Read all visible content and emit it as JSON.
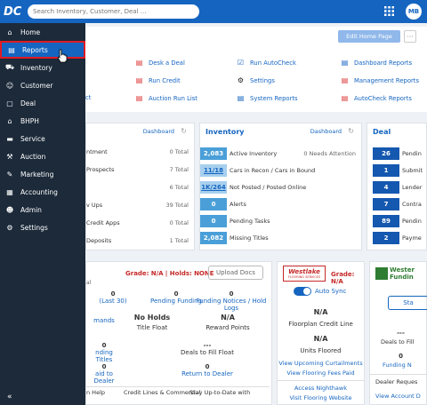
{
  "header": {
    "logo": "DC",
    "search_placeholder": "Search Inventory, Customer, Deal ...",
    "avatar": "MB"
  },
  "sidebar": {
    "items": [
      {
        "label": "Home",
        "icon": "home-icon"
      },
      {
        "label": "Reports",
        "icon": "report-icon",
        "active": true
      },
      {
        "label": "Inventory",
        "icon": "car-icon"
      },
      {
        "label": "Customer",
        "icon": "person-icon"
      },
      {
        "label": "Deal",
        "icon": "deal-icon"
      },
      {
        "label": "BHPH",
        "icon": "bhph-icon"
      },
      {
        "label": "Service",
        "icon": "service-icon"
      },
      {
        "label": "Auction",
        "icon": "auction-icon"
      },
      {
        "label": "Marketing",
        "icon": "marketing-icon"
      },
      {
        "label": "Accounting",
        "icon": "accounting-icon"
      },
      {
        "label": "Admin",
        "icon": "admin-icon"
      },
      {
        "label": "Settings",
        "icon": "settings-icon"
      }
    ],
    "collapse": "«"
  },
  "quick": {
    "edit_label": "Edit Home Page",
    "more": "···",
    "col0": [
      "ct"
    ],
    "col1": [
      "Desk a Deal",
      "Run Credit",
      "Auction Run List"
    ],
    "col2": [
      "Run AutoCheck",
      "Settings",
      "System Reports"
    ],
    "col3": [
      "Dashboard Reports",
      "Management Reports",
      "AutoCheck Reports"
    ]
  },
  "leftcard": {
    "dashboard": "Dashboard",
    "rows": [
      {
        "label": "ntment",
        "value": "0 Total"
      },
      {
        "label": "Prospects",
        "value": "7 Total"
      },
      {
        "label": "",
        "value": "6 Total"
      },
      {
        "label": "v Ups",
        "value": "39 Total"
      },
      {
        "label": "Credit Apps",
        "value": "0 Total"
      },
      {
        "label": "Deposits",
        "value": "1 Total"
      }
    ]
  },
  "inventory": {
    "title": "Inventory",
    "dashboard": "Dashboard",
    "rows": [
      {
        "badge": "2,083",
        "label": "Active Inventory",
        "right": "0 Needs Attention"
      },
      {
        "badge": "11/18",
        "label": "Cars in Recon / Cars in Bound",
        "right": ""
      },
      {
        "badge": "1K/264",
        "label": "Not Posted / Posted Online",
        "right": ""
      },
      {
        "badge": "0",
        "label": "Alerts",
        "right": ""
      },
      {
        "badge": "0",
        "label": "Pending Tasks",
        "right": ""
      },
      {
        "badge": "2,082",
        "label": "Missing Titles",
        "right": ""
      }
    ]
  },
  "deal": {
    "title": "Deal",
    "rows": [
      {
        "badge": "26",
        "label": "Pendin"
      },
      {
        "badge": "1",
        "label": "Submit"
      },
      {
        "badge": "4",
        "label": "Lender"
      },
      {
        "badge": "7",
        "label": "Contra"
      },
      {
        "badge": "89",
        "label": "Pendin"
      },
      {
        "badge": "2",
        "label": "Payme"
      }
    ]
  },
  "floor": {
    "grade_label": "Grade:",
    "grade_value": "N/A",
    "holds_label": "| Holds:",
    "holds_value": "NONE",
    "upload": "Upload Docs",
    "partial_l": "al",
    "items": [
      {
        "value": "0",
        "label": "(Last 30)"
      },
      {
        "value": "0",
        "label": "Pending Funding"
      },
      {
        "value": "0",
        "label": "Funding Notices / Hold Logs"
      }
    ],
    "holds_text": "No Holds",
    "title_float": "Title Float",
    "na_value": "N/A",
    "reward": "Reward Points",
    "mands": "mands",
    "zero_a": "0",
    "dashes": "---",
    "nding_titles": "nding Titles",
    "deals_fill": "Deals to Fill Float",
    "zero_b": "0",
    "zero_c": "0",
    "aid_dealer": "aid to Dealer",
    "return_dealer": "Return to Dealer",
    "bottom1": "n Help",
    "bottom2": "Credit Lines & Commercial",
    "bottom3": "Stay Up-to-Date with"
  },
  "westlake": {
    "logo_text": "Westlake",
    "logo_sub": "FLOORING SERVICES",
    "grade": "Grade:",
    "grade_value": "N/A",
    "autosync": "Auto Sync",
    "na1": "N/A",
    "credit_line": "Floorplan Credit Line",
    "na2": "N/A",
    "units": "Units Floored",
    "link1": "View Upcoming Curtailments",
    "link2": "View Flooring Fees Paid",
    "link3": "Access Nighthawk",
    "link4": "Visit Flooring Website"
  },
  "westernfund": {
    "logo_text": "Wester",
    "logo_sub": "Fundin",
    "btn": "Sta",
    "dashes": "---",
    "deals_fill": "Deals to Fill",
    "zero": "0",
    "funding": "Funding N",
    "dealer_req": "Dealer Reques",
    "view_acct": "View Account D"
  }
}
